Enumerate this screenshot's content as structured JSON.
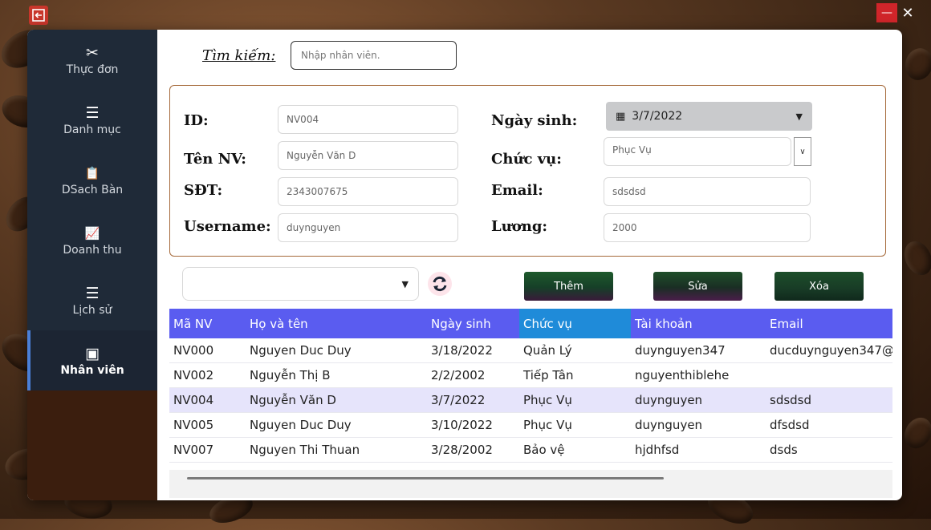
{
  "window": {
    "minimize_icon": "minimize-icon",
    "close_icon": "close-icon",
    "minimize_glyph": "—",
    "close_glyph": "✕"
  },
  "sidebar": {
    "items": [
      {
        "label": "Thực đơn",
        "icon": "utensils-icon",
        "glyph": "✂"
      },
      {
        "label": "Danh mục",
        "icon": "list-icon",
        "glyph": "☰"
      },
      {
        "label": "DSach Bàn",
        "icon": "clipboard-icon",
        "glyph": "📋"
      },
      {
        "label": "Doanh thu",
        "icon": "chart-icon",
        "glyph": "📈"
      },
      {
        "label": "Lịch sử",
        "icon": "list-icon",
        "glyph": "☰"
      },
      {
        "label": "Nhân viên",
        "icon": "badge-icon",
        "glyph": "▣"
      }
    ],
    "active": "Nhân viên"
  },
  "search": {
    "label": "Tìm kiếm:",
    "placeholder": "Nhập nhân viên."
  },
  "form": {
    "id_label": "ID:",
    "id_value": "NV004",
    "name_label": "Tên NV:",
    "name_value": "Nguyễn Văn D",
    "phone_label": "SĐT:",
    "phone_value": "2343007675",
    "username_label": "Username:",
    "username_value": "duynguyen",
    "dob_label": "Ngày sinh:",
    "dob_value": "3/7/2022",
    "role_label": "Chức vụ:",
    "role_value": "Phục Vụ",
    "email_label": "Email:",
    "email_value": "sdsdsd",
    "salary_label": "Lương:",
    "salary_value": "2000"
  },
  "actions": {
    "add": "Thêm",
    "edit": "Sửa",
    "delete": "Xóa"
  },
  "table": {
    "headers": [
      "Mã NV",
      "Họ và tên",
      "Ngày sinh",
      "Chức vụ",
      "Tài khoản",
      "Email"
    ],
    "selected_header": "Chức vụ",
    "rows": [
      [
        "NV000",
        "Nguyen  Duc Duy",
        "3/18/2022",
        "Quản Lý",
        "duynguyen347",
        "ducduynguyen347@"
      ],
      [
        "NV002",
        "Nguyễn Thị B",
        "2/2/2002",
        "Tiếp Tân",
        "nguyenthiblehe",
        ""
      ],
      [
        "NV004",
        "Nguyễn Văn D",
        "3/7/2022",
        "Phục Vụ",
        "duynguyen",
        "sdsdsd"
      ],
      [
        "NV005",
        "Nguyen Duc Duy",
        "3/10/2022",
        "Phục Vụ",
        "duynguyen",
        "dfsdsd"
      ],
      [
        "NV007",
        "Nguyen Thi Thuan",
        "3/28/2002",
        "Bảo vệ",
        "hjdhfsd",
        "dsds"
      ]
    ],
    "selected_row": "NV004"
  },
  "colors": {
    "sidebar": "#1f2a38",
    "header": "#5a5cf0",
    "header_selected": "#1f8bd9",
    "row_selected": "#e6e4fb",
    "panel_border": "#a5693a"
  }
}
